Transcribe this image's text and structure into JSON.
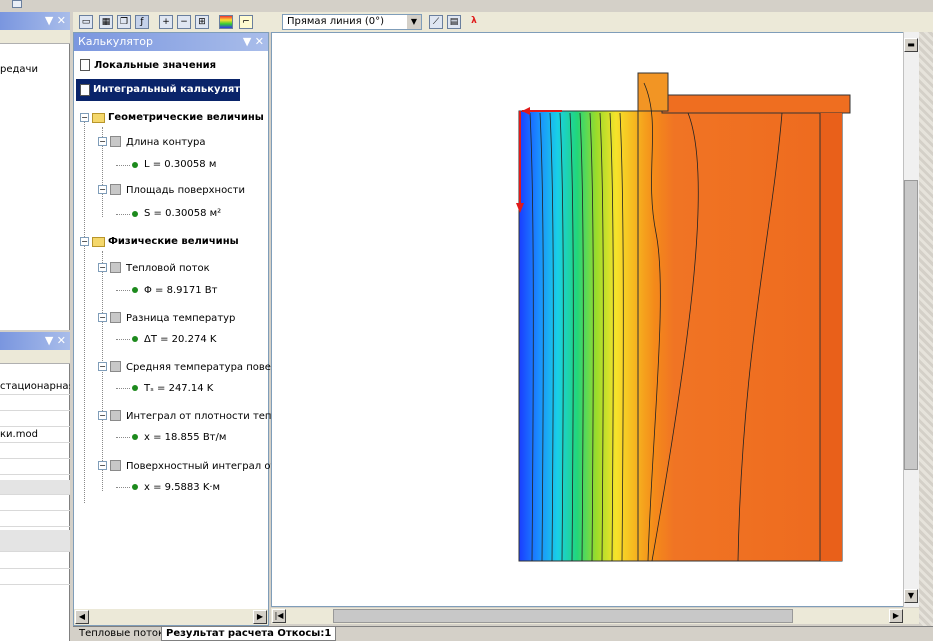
{
  "toolbar": {
    "dropdown_value": "Прямая линия (0°)",
    "colors": {
      "accent_blue": "#0a246a",
      "title_grad": "#7a96df"
    }
  },
  "calculator": {
    "title": "Калькулятор",
    "title_controls": "▼ ✕",
    "local_values": "Локальные значения",
    "integral_calc": "Интегральный калькулятор",
    "geometric": "Геометрические величины",
    "contour_length": "Длина контура",
    "contour_length_value": "L = 0.30058 м",
    "surface_area": "Площадь поверхности",
    "surface_area_value": "S = 0.30058 м²",
    "physical": "Физические величины",
    "heat_flux": "Тепловой поток",
    "heat_flux_value": "Φ = 8.9171 Вт",
    "temp_diff": "Разница температур",
    "temp_diff_value": "ΔT = 20.274 K",
    "avg_surface_temp": "Средняя температура поверхно",
    "avg_surface_temp_value": "Tₛ = 247.14 K",
    "integral_density": "Интеграл от плотности теплово",
    "integral_density_value": "x = 18.855 Вт/м",
    "surface_integral": "Поверхностный интеграл от gra",
    "surface_integral_value": "x = 9.5883 K·м"
  },
  "left_top": {
    "title_controls": "▼ ✕",
    "partial_text": "редачи"
  },
  "left_bottom": {
    "title_controls": "▼ ✕",
    "rows": [
      "стационарная",
      "",
      "",
      "ки.mod",
      "",
      "",
      "",
      "",
      "",
      "",
      "",
      ""
    ]
  },
  "tabs": {
    "items": [
      "Тепловые потоки",
      "Результат расчета Откосы:1"
    ]
  },
  "plot": {
    "type": "thermal-field"
  }
}
